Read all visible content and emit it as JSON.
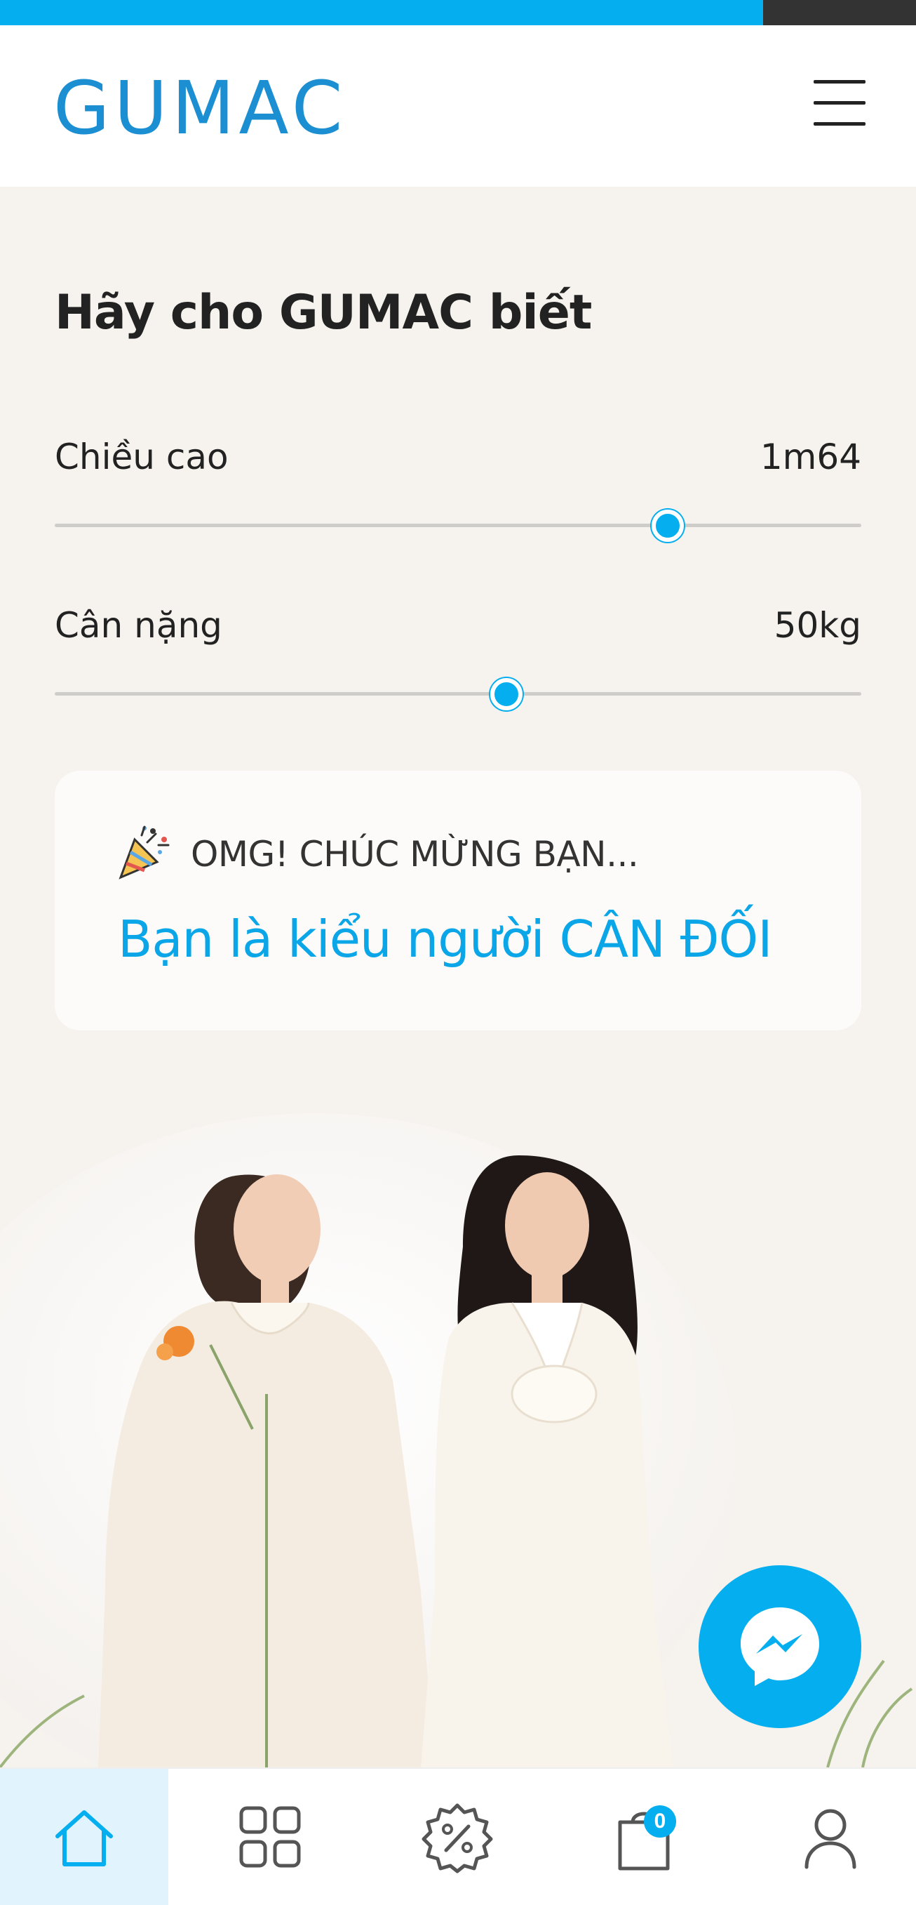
{
  "brand": {
    "logo": "GUMAC",
    "accent": "#05aeef",
    "logo_color": "#1b8fd1"
  },
  "header": {
    "menu_icon": "hamburger-menu-icon"
  },
  "form": {
    "title": "Hãy cho GUMAC biết",
    "height": {
      "label": "Chiều cao",
      "value": "1m64",
      "level_percent": 76
    },
    "weight": {
      "label": "Cân nặng",
      "value": "50kg",
      "level_percent": 56
    }
  },
  "result": {
    "icon": "party-popper-icon",
    "subtitle": "OMG! CHÚC MỪNG BẠN...",
    "message": "Bạn là kiểu người CÂN ĐỐI"
  },
  "hero": {
    "image": "two-women-in-white-dresses-photo"
  },
  "chat": {
    "icon": "messenger-icon"
  },
  "bottom_nav": {
    "items": [
      {
        "icon": "home-icon",
        "active": true
      },
      {
        "icon": "categories-grid-icon",
        "active": false
      },
      {
        "icon": "discount-badge-icon",
        "active": false
      },
      {
        "icon": "shopping-bag-icon",
        "active": false
      },
      {
        "icon": "user-account-icon",
        "active": false
      }
    ],
    "cart_count": "0"
  }
}
